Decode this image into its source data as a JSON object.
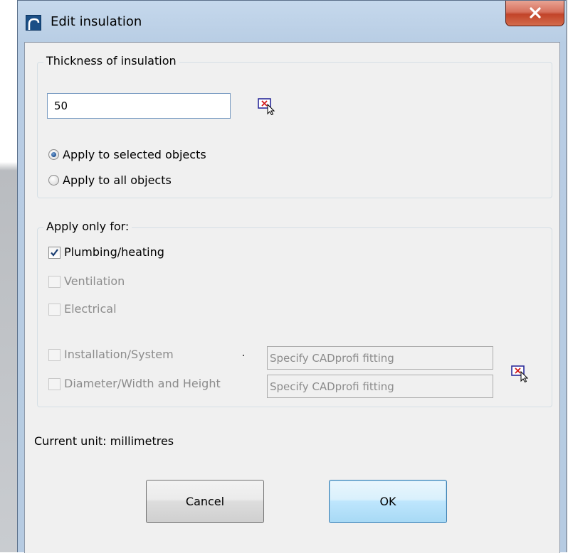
{
  "window": {
    "title": "Edit insulation"
  },
  "thickness_group": {
    "legend": "Thickness of insulation",
    "value": "50",
    "apply_selected_label": "Apply to selected objects",
    "apply_all_label": "Apply to all objects",
    "selected_option": "Apply to selected objects"
  },
  "apply_group": {
    "legend": "Apply only for:",
    "plumbing_label": "Plumbing/heating",
    "plumbing_checked": true,
    "ventilation_label": "Ventilation",
    "electrical_label": "Electrical",
    "installation_label": "Installation/System",
    "diameter_label": "Diameter/Width and Height",
    "installation_fitting_value": "Specify CADprofi fitting",
    "diameter_fitting_value": "Specify CADprofi fitting"
  },
  "status": {
    "unit_text": "Current unit: millimetres"
  },
  "buttons": {
    "cancel_label": "Cancel",
    "ok_label": "OK"
  },
  "icons": {
    "app": "app-logo-icon",
    "close": "close-icon",
    "pick": "pick-object-icon"
  },
  "colors": {
    "titlebar": "#c5d8ec",
    "dialog_background": "#f0f0f0",
    "close_button": "#c24429",
    "radio_dot": "#1e4f90",
    "checkmark": "#1c3f73",
    "disabled_text": "#8c8c8c"
  }
}
